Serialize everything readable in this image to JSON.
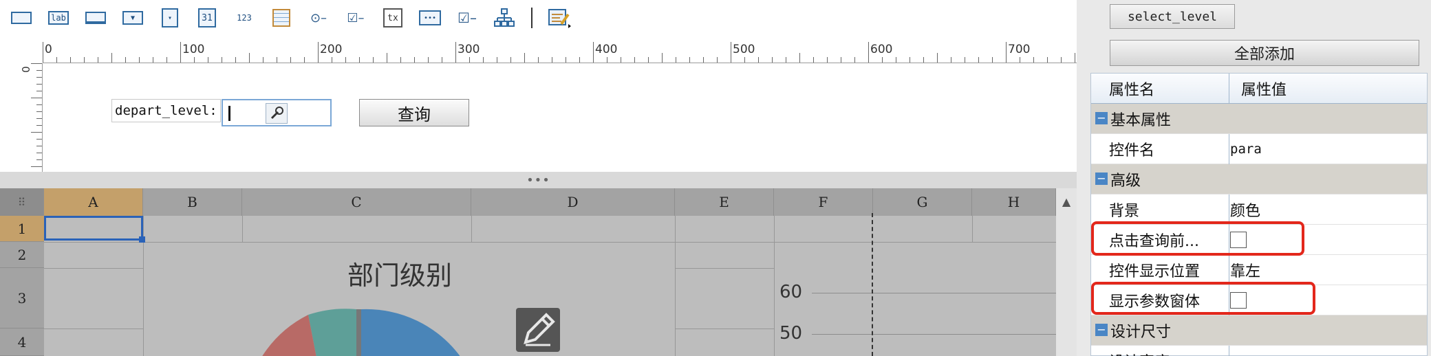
{
  "toolbar": {
    "items": [
      "textbox-icon",
      "label-icon",
      "button-icon",
      "dropdown-icon",
      "tree-dropdown-icon",
      "date-icon",
      "number-icon",
      "table-icon",
      "radio-group-icon",
      "checkbox-group-icon",
      "text-area-icon",
      "password-icon",
      "checkbox-icon",
      "tree-icon",
      "widget-settings-icon"
    ],
    "label_lab": "lab",
    "date_31": "31",
    "num_123": "123",
    "tx": "tx",
    "dots": "•••"
  },
  "ruler": {
    "labels": [
      "0",
      "100",
      "200",
      "300",
      "400",
      "500",
      "600",
      "700"
    ],
    "v_label": "0"
  },
  "form": {
    "param_label": "depart_level:",
    "query_button": "查询"
  },
  "splitter": {
    "grip": "•••"
  },
  "sheet": {
    "corner": "⠿",
    "columns": [
      "A",
      "B",
      "C",
      "D",
      "E",
      "F",
      "G",
      "H"
    ],
    "rows": [
      "1",
      "2",
      "3",
      "4"
    ],
    "chart_title": "部门级别",
    "y_ticks": [
      "60",
      "50"
    ]
  },
  "panel": {
    "select_button": "select_level",
    "add_all_button": "全部添加",
    "header_name": "属性名",
    "header_value": "属性值",
    "group_basic": "基本属性",
    "row_widget_name": "控件名",
    "row_widget_name_value": "para",
    "group_advanced": "高级",
    "row_background": "背景",
    "row_background_value": "颜色",
    "row_click_query": "点击查询前...",
    "row_display_pos": "控件显示位置",
    "row_display_pos_value": "靠左",
    "row_show_param": "显示参数窗体",
    "group_design_size": "设计尺寸",
    "row_partial": "设计宽度"
  },
  "colors": {
    "accent": "#2a62b8",
    "highlight_red": "#e3271b",
    "selected_header": "#c4a06a",
    "pie_blue": "#4a85b8",
    "pie_red": "#b86a66",
    "pie_teal": "#5e9f98"
  }
}
